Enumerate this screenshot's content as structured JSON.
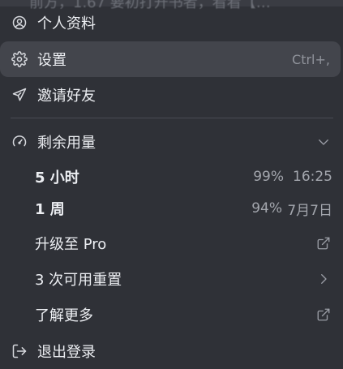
{
  "background": {
    "blurred_text": "前方，1.67 要初打开书者，看看【…"
  },
  "menu": {
    "profile": {
      "label": "个人资料",
      "icon": "user-circle-icon"
    },
    "settings": {
      "label": "设置",
      "shortcut": "Ctrl+,",
      "icon": "gear-icon"
    },
    "invite": {
      "label": "邀请好友",
      "icon": "paper-plane-icon"
    },
    "usage": {
      "label": "剩余用量",
      "icon": "gauge-icon",
      "expanded_icon": "chevron-down-icon",
      "rows": [
        {
          "label": "5 小时",
          "percent": "99%",
          "reset": "16:25"
        },
        {
          "label": "1 周",
          "percent": "94%",
          "reset": "7月7日"
        }
      ]
    },
    "upgrade": {
      "label": "升级至 Pro",
      "icon": "external-link-icon"
    },
    "resets": {
      "label": "3 次可用重置",
      "icon": "chevron-right-icon"
    },
    "learn_more": {
      "label": "了解更多",
      "icon": "external-link-icon"
    },
    "logout": {
      "label": "退出登录",
      "icon": "logout-icon"
    }
  },
  "colors": {
    "menu_bg": "#2f3137",
    "highlight_bg": "#43454c",
    "text": "#eceef2",
    "muted": "#a3a6ad",
    "divider": "#4a4c53"
  }
}
